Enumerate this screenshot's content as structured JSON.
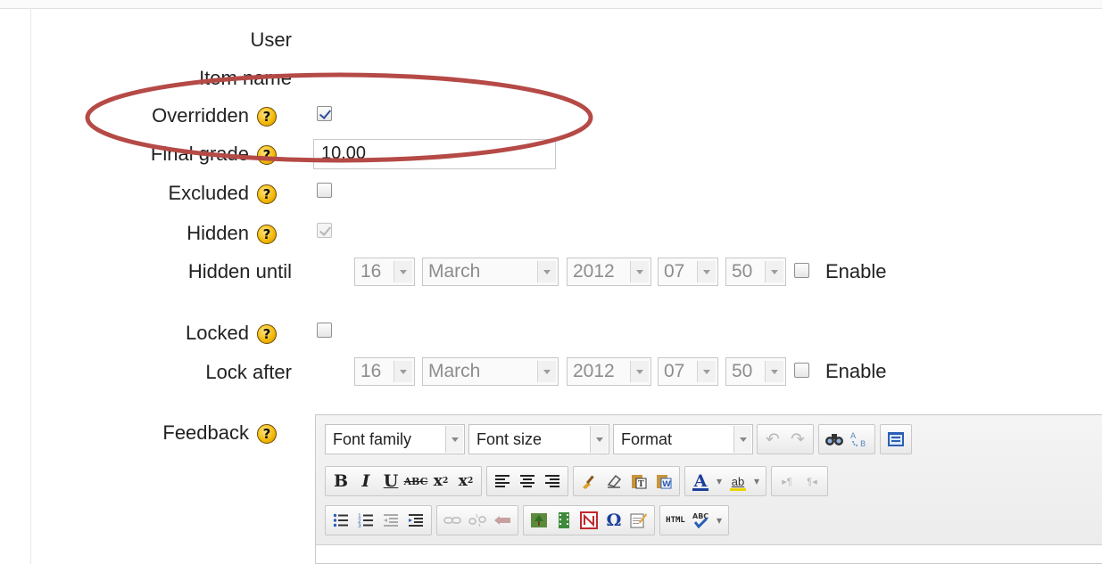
{
  "form": {
    "user_label": "User",
    "user_value": "",
    "item_name_label": "Item name",
    "item_name_value": "",
    "overridden_label": "Overridden",
    "overridden_checked": true,
    "final_grade_label": "Final grade",
    "final_grade_value": "10.00",
    "excluded_label": "Excluded",
    "excluded_checked": false,
    "hidden_label": "Hidden",
    "hidden_checked": true,
    "hidden_until_label": "Hidden until",
    "hidden_until": {
      "day": "16",
      "month": "March",
      "year": "2012",
      "hour": "07",
      "minute": "50",
      "enable_label": "Enable",
      "enabled": false
    },
    "locked_label": "Locked",
    "locked_checked": false,
    "lock_after_label": "Lock after",
    "lock_after": {
      "day": "16",
      "month": "March",
      "year": "2012",
      "hour": "07",
      "minute": "50",
      "enable_label": "Enable",
      "enabled": false
    },
    "feedback_label": "Feedback"
  },
  "editor": {
    "font_family": "Font family",
    "font_size": "Font size",
    "format": "Format",
    "row1_icons": [
      "undo-icon",
      "redo-icon",
      "find-icon",
      "replace-icon",
      "fullscreen-icon"
    ],
    "row2_icons": [
      "bold-icon",
      "italic-icon",
      "underline-icon",
      "strikethrough-icon",
      "subscript-icon",
      "superscript-icon",
      "align-left-icon",
      "align-center-icon",
      "align-right-icon",
      "cleanup-icon",
      "remove-format-icon",
      "paste-text-icon",
      "paste-word-icon",
      "text-color-icon",
      "highlight-color-icon",
      "ltr-icon",
      "rtl-icon"
    ],
    "row3_icons": [
      "bullet-list-icon",
      "numbered-list-icon",
      "outdent-icon",
      "indent-icon",
      "link-icon",
      "unlink-icon",
      "anchor-icon",
      "image-icon",
      "media-icon",
      "no-autolink-icon",
      "special-char-icon",
      "edit-icon",
      "html-source-icon",
      "spellcheck-icon"
    ]
  },
  "annotation": {
    "color": "#b54a46"
  },
  "colors": {
    "highlight": "#e8d500",
    "text_color": "#1b3f9c"
  }
}
